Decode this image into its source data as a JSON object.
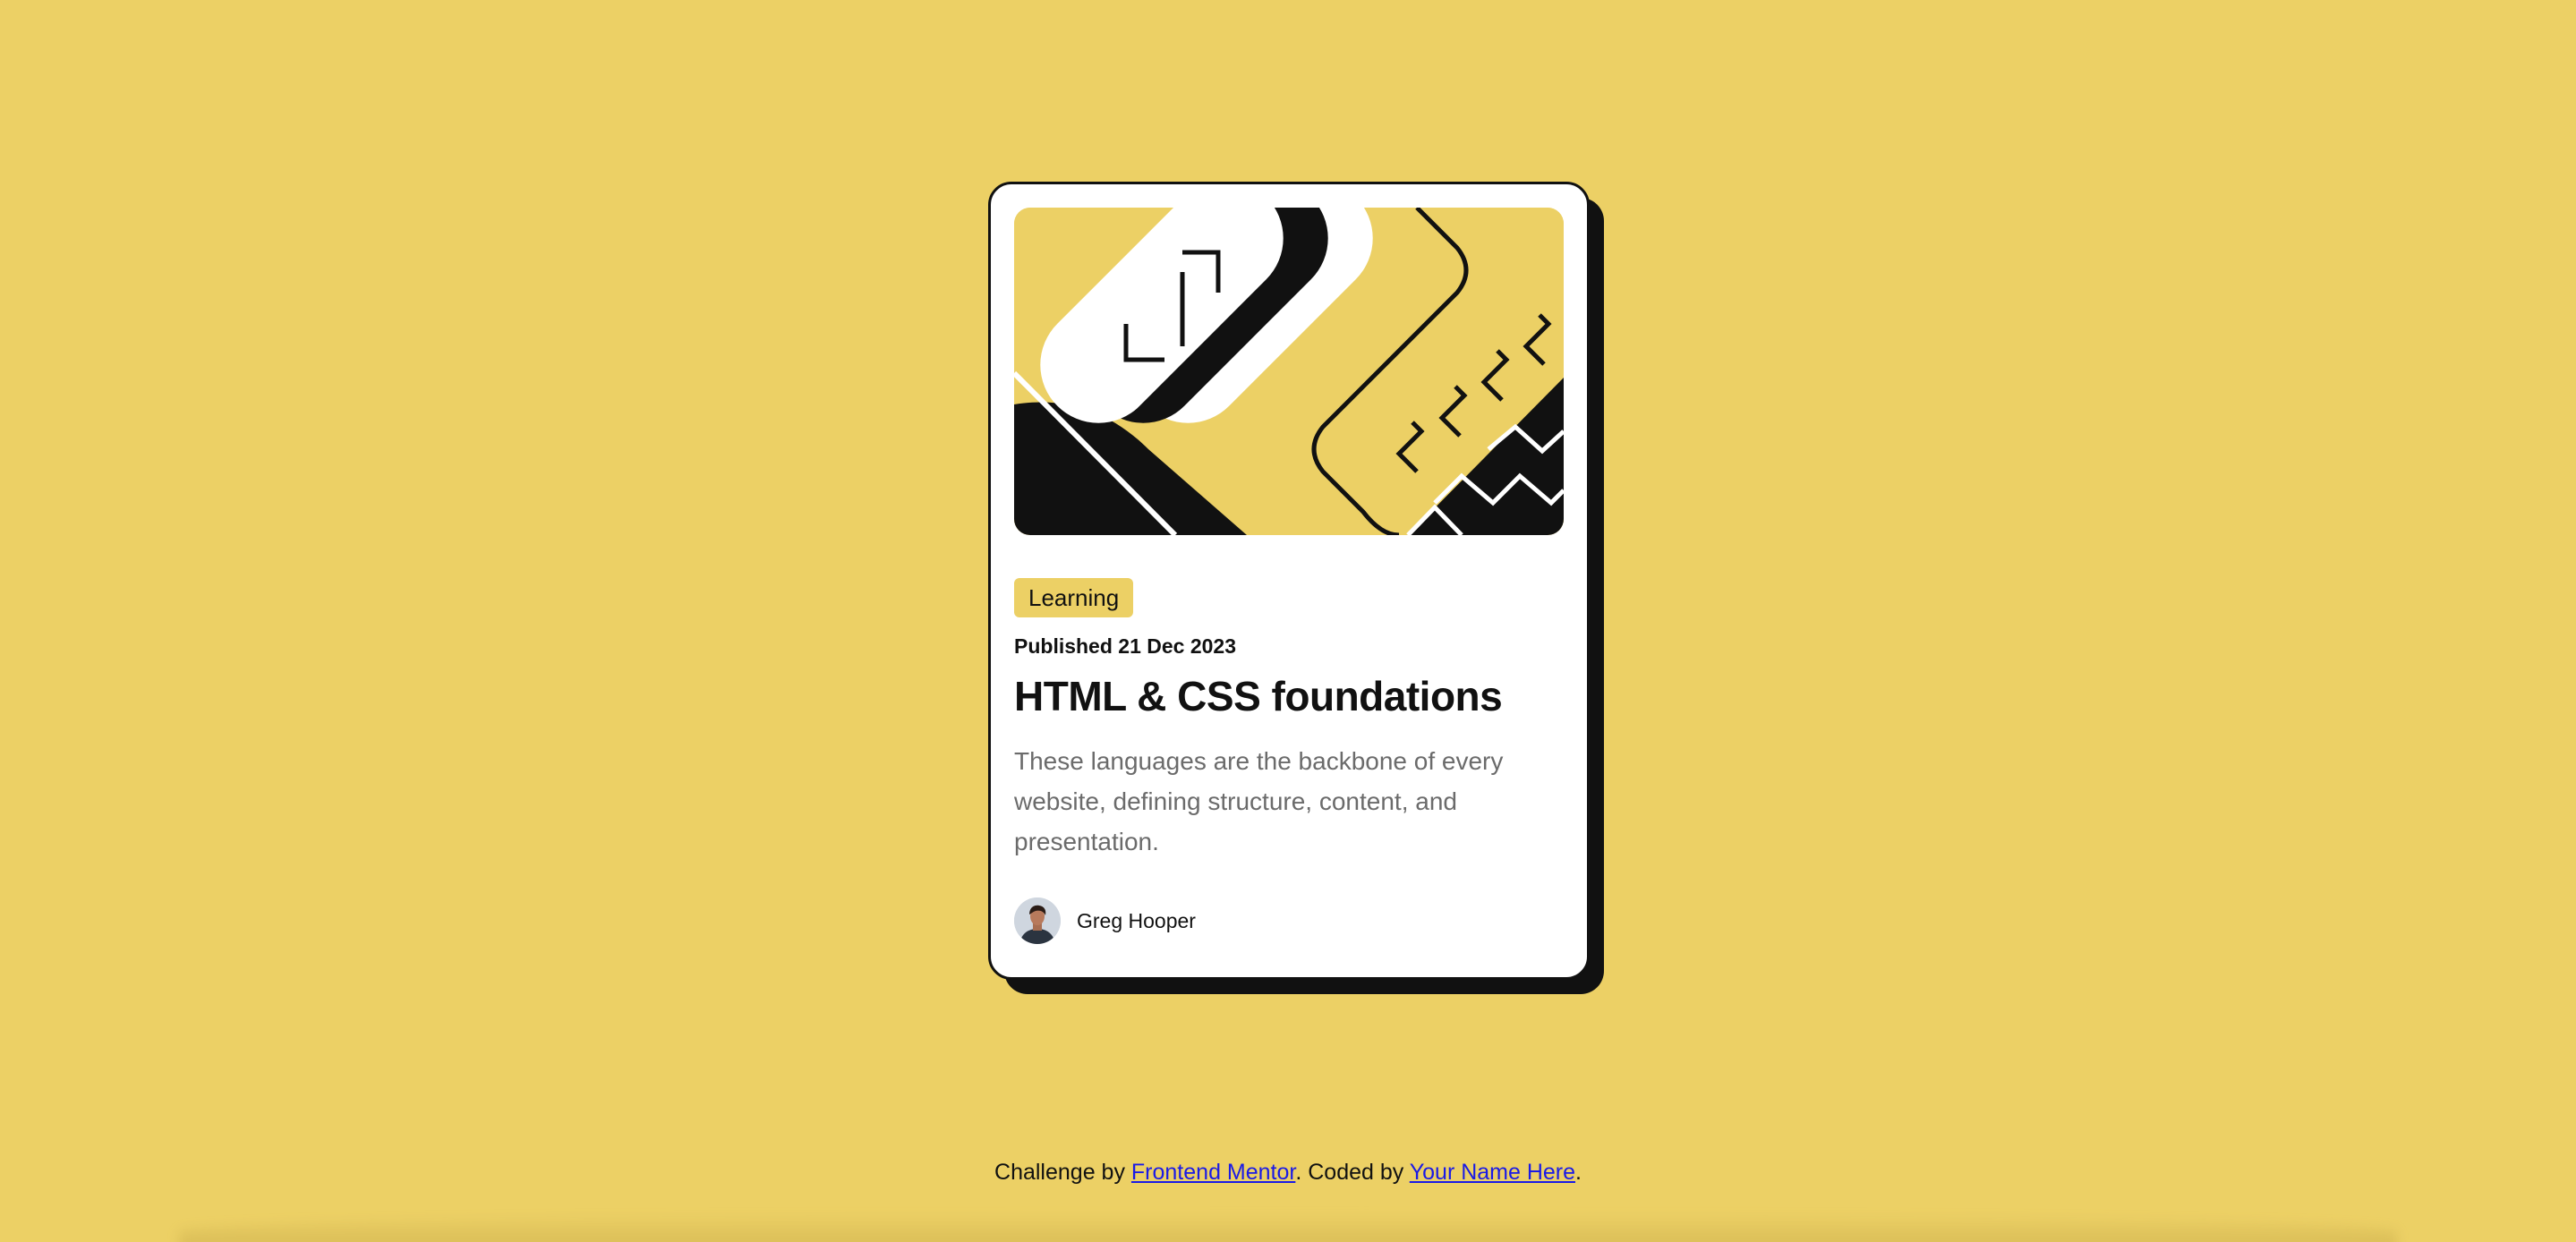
{
  "card": {
    "tag": "Learning",
    "published": "Published 21 Dec 2023",
    "title": "HTML & CSS foundations",
    "description": "These languages are the backbone of every website, defining structure, content, and presentation.",
    "author": {
      "name": "Greg Hooper",
      "avatar_icon": "person-avatar-icon"
    },
    "hero_icon": "abstract-illustration-icon"
  },
  "footer": {
    "prefix": "Challenge by ",
    "link1": "Frontend Mentor",
    "middle": ". Coded by ",
    "link2": "Your Name Here",
    "suffix": "."
  },
  "colors": {
    "background": "#ecd065",
    "card": "#ffffff",
    "ink": "#111111",
    "muted_text": "#6b6b6b",
    "link": "#1a1ae6"
  }
}
